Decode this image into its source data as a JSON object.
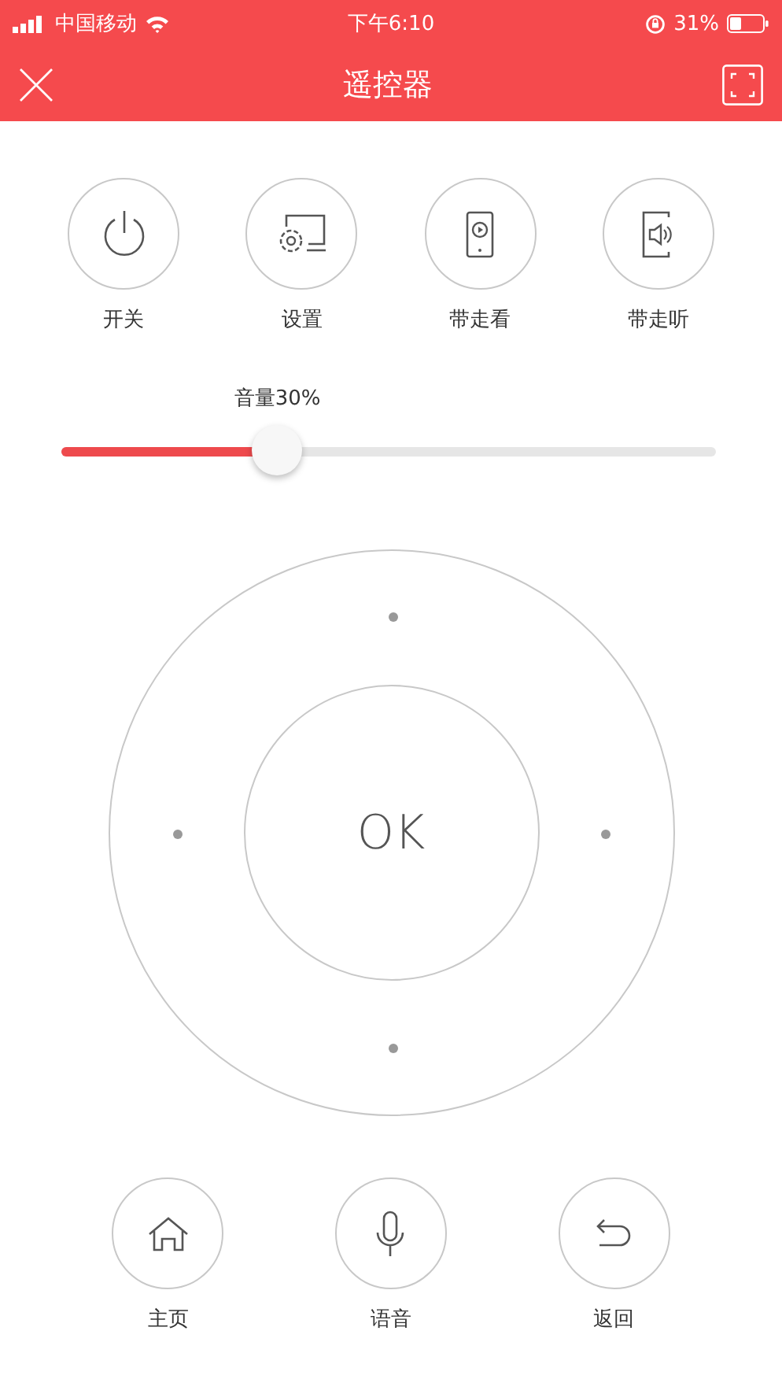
{
  "status_bar": {
    "carrier": "中国移动",
    "time": "下午6:10",
    "battery": "31%"
  },
  "header": {
    "title": "遥控器"
  },
  "top_buttons": [
    {
      "kind": "power",
      "label": "开关"
    },
    {
      "kind": "settings",
      "label": "设置"
    },
    {
      "kind": "phone-video",
      "label": "带走看"
    },
    {
      "kind": "phone-sound",
      "label": "带走听"
    }
  ],
  "volume": {
    "label": "音量30%",
    "level": 0.33
  },
  "dpad": {
    "center_label": "OK"
  },
  "bottom_buttons": [
    {
      "kind": "home",
      "label": "主页"
    },
    {
      "kind": "mic",
      "label": "语音"
    },
    {
      "kind": "back",
      "label": "返回"
    }
  ]
}
